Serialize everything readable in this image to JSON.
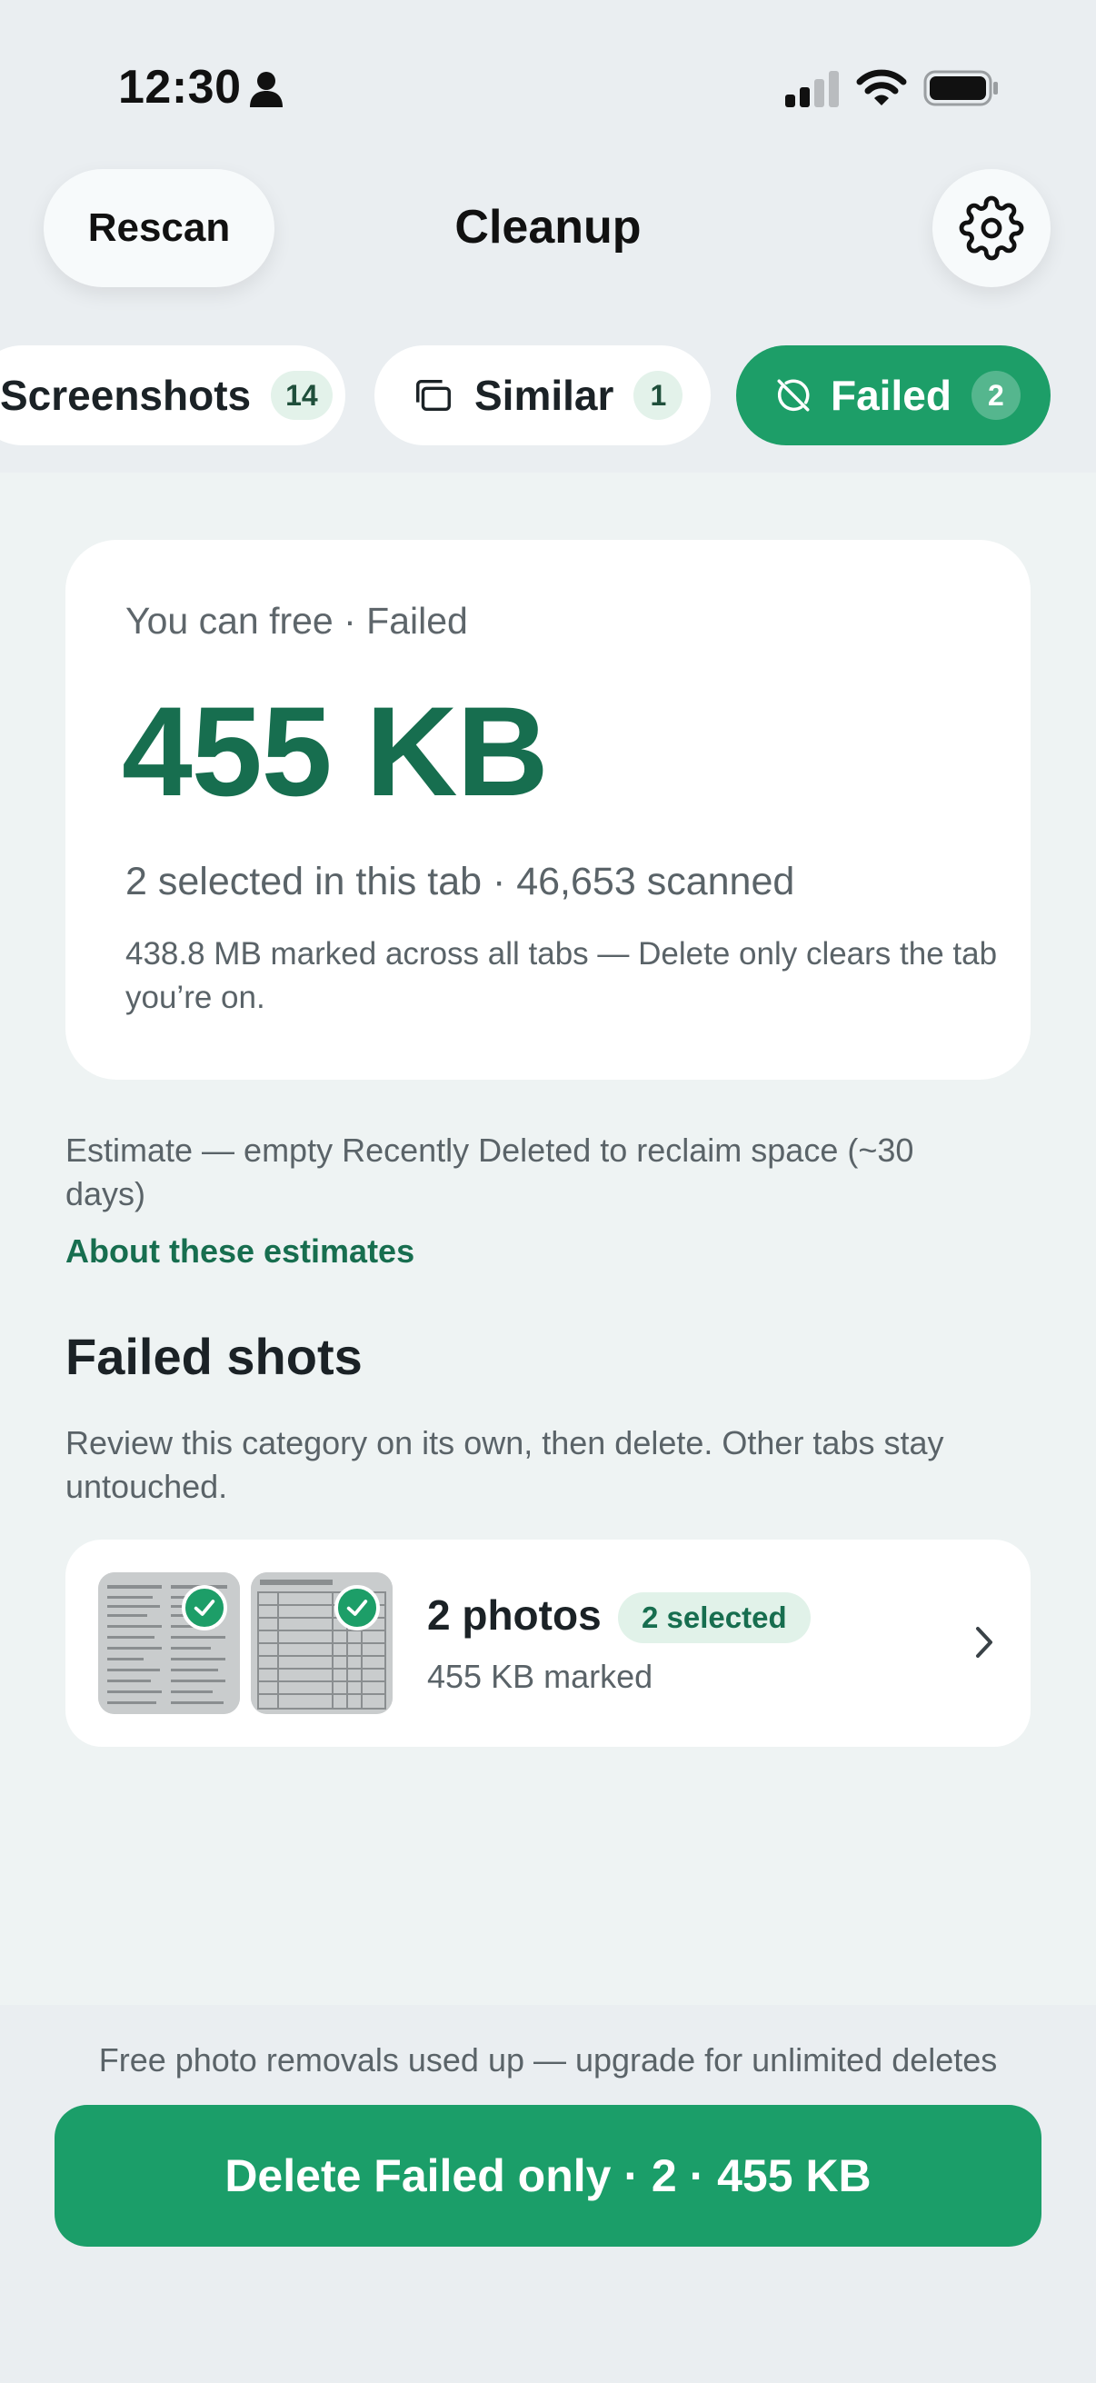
{
  "status_bar": {
    "time": "12:30"
  },
  "header": {
    "rescan_label": "Rescan",
    "title": "Cleanup"
  },
  "tabs": [
    {
      "label": "Screenshots",
      "count": "14"
    },
    {
      "label": "Similar",
      "count": "1"
    },
    {
      "label": "Failed",
      "count": "2",
      "active": true
    }
  ],
  "summary": {
    "label": "You can free · Failed",
    "size": "455 KB",
    "selected": "2 selected in this tab · 46,653 scanned",
    "note": "438.8 MB marked across all tabs — Delete only clears the tab you’re on."
  },
  "estimate": {
    "note": "Estimate — empty Recently Deleted to reclaim space (~30 days)",
    "link": "About these estimates"
  },
  "section": {
    "title": "Failed shots",
    "description": "Review this category on its own, then delete. Other tabs stay untouched."
  },
  "group": {
    "title": "2 photos",
    "badge": "2 selected",
    "subtitle": "455 KB marked"
  },
  "footer": {
    "upgrade_note": "Free photo removals used up — upgrade for unlimited deletes",
    "delete_label": "Delete Failed only · 2 · 455 KB"
  },
  "colors": {
    "accent": "#1d9e68",
    "accent_dark": "#176e4f",
    "badge_bg": "#e1f2e9"
  },
  "icons": [
    "person-icon",
    "signal-icon",
    "wifi-icon",
    "battery-icon",
    "gear-icon",
    "stack-icon",
    "failed-icon",
    "checkmark-icon",
    "chevron-right-icon"
  ]
}
